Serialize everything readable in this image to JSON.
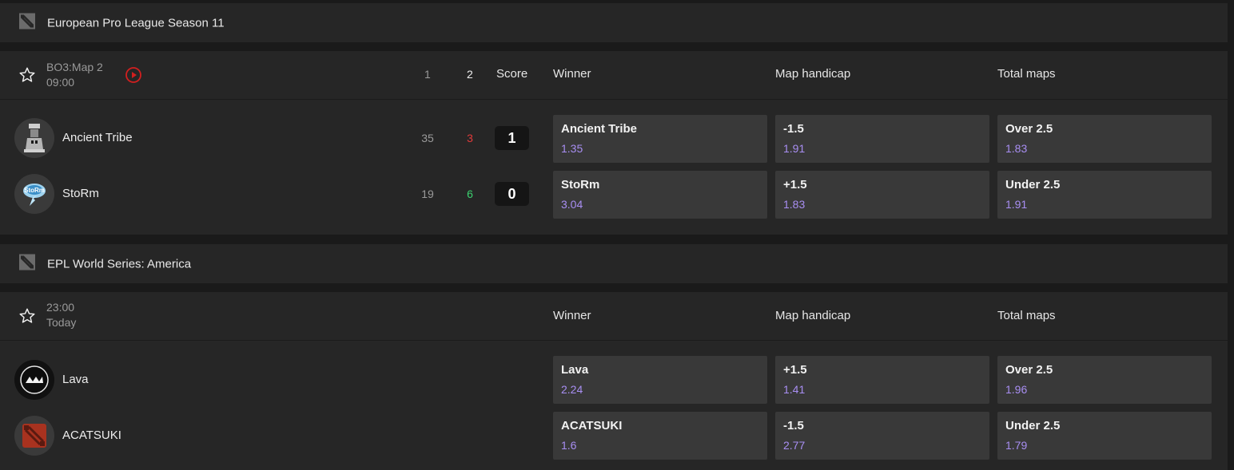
{
  "leagues": [
    {
      "name": "European Pro League Season 11",
      "match": {
        "meta_line1": "BO3:Map 2",
        "meta_line2": "09:00",
        "header_map1": "1",
        "header_map2": "2",
        "header_score": "Score",
        "columns": [
          "Winner",
          "Map handicap",
          "Total maps"
        ],
        "teams": [
          {
            "name": "Ancient Tribe",
            "stat1": "35",
            "stat2": "3",
            "score": "1",
            "winner": {
              "label": "Ancient Tribe",
              "odds": "1.35"
            },
            "handicap": {
              "label": "-1.5",
              "odds": "1.91"
            },
            "total": {
              "label": "Over 2.5",
              "odds": "1.83"
            }
          },
          {
            "name": "StoRm",
            "stat1": "19",
            "stat2": "6",
            "score": "0",
            "winner": {
              "label": "StoRm",
              "odds": "3.04"
            },
            "handicap": {
              "label": "+1.5",
              "odds": "1.83"
            },
            "total": {
              "label": "Under 2.5",
              "odds": "1.91"
            }
          }
        ]
      }
    },
    {
      "name": "EPL World Series: America",
      "match": {
        "meta_line1": "23:00",
        "meta_line2": "Today",
        "columns": [
          "Winner",
          "Map handicap",
          "Total maps"
        ],
        "teams": [
          {
            "name": "Lava",
            "winner": {
              "label": "Lava",
              "odds": "2.24"
            },
            "handicap": {
              "label": "+1.5",
              "odds": "1.41"
            },
            "total": {
              "label": "Over 2.5",
              "odds": "1.96"
            }
          },
          {
            "name": "ACATSUKI",
            "winner": {
              "label": "ACATSUKI",
              "odds": "1.6"
            },
            "handicap": {
              "label": "-1.5",
              "odds": "2.77"
            },
            "total": {
              "label": "Under 2.5",
              "odds": "1.79"
            }
          }
        ]
      }
    }
  ],
  "colors": {
    "odds": "#a88ef2",
    "stat_red": "#e03a3a",
    "stat_green": "#3bd16f",
    "live_red": "#d21f1f"
  },
  "icons": [
    "dota-icon",
    "star-icon",
    "live-play-icon",
    "team-logo"
  ]
}
